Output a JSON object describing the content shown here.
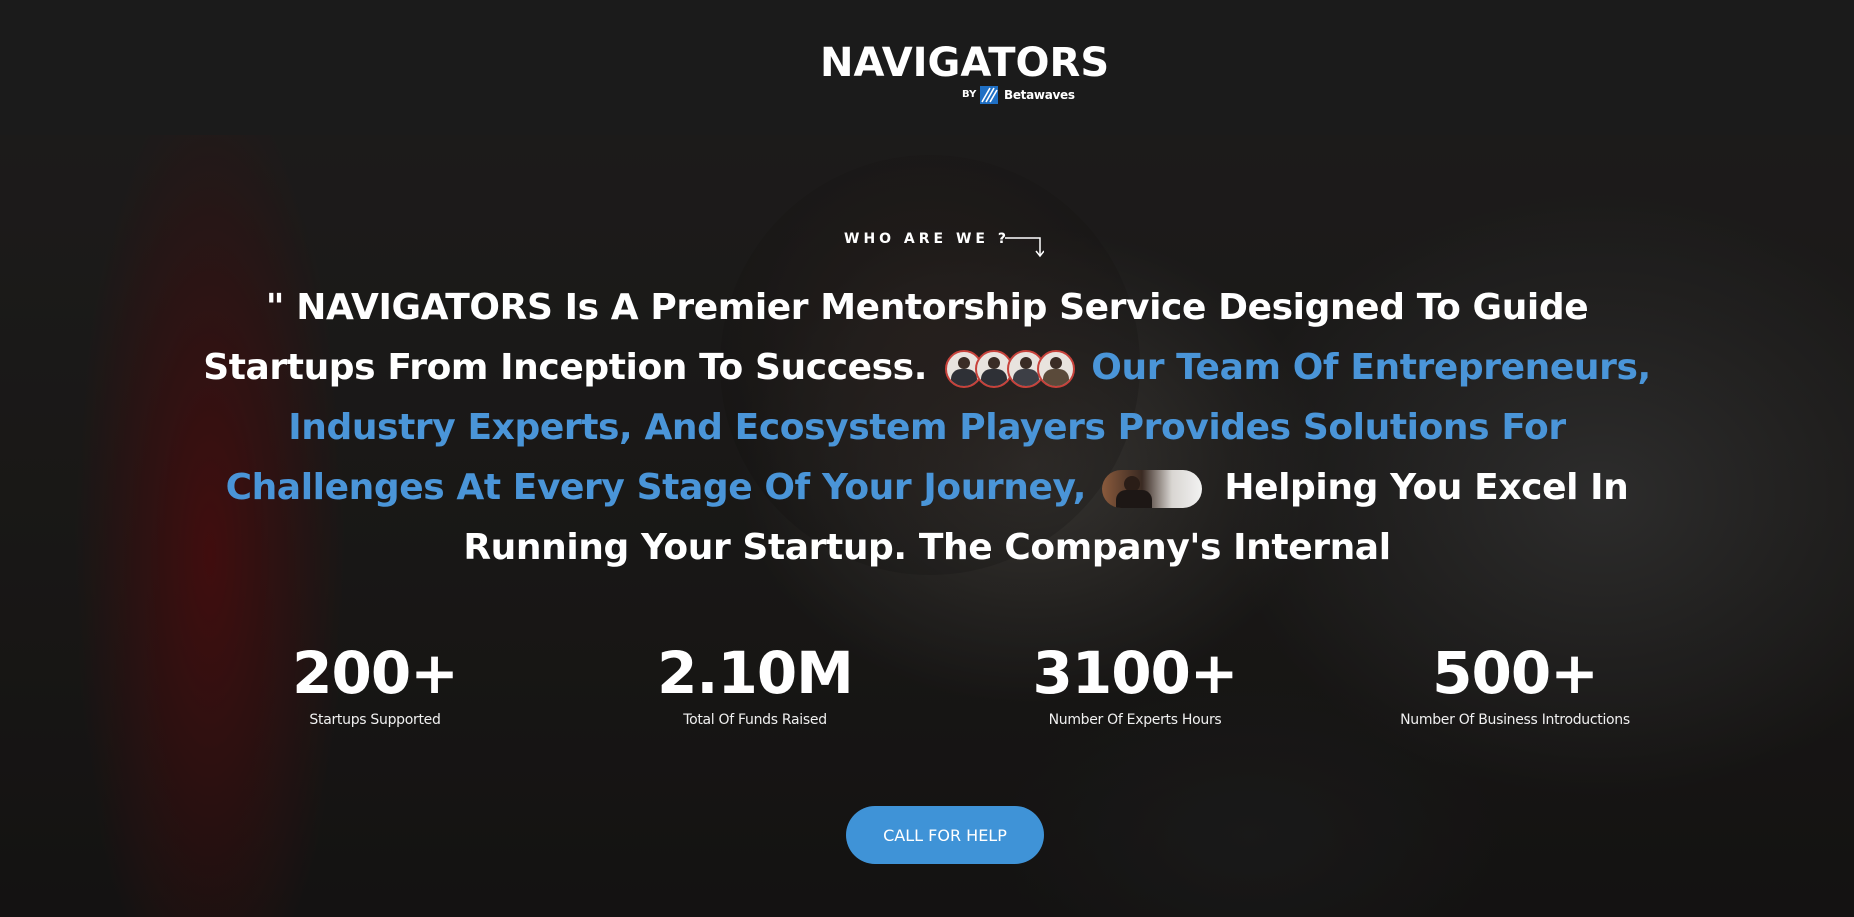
{
  "header": {
    "logo_text": "NAVIGATORS",
    "logo_by": "BY",
    "logo_company": "Betawaves"
  },
  "hero": {
    "eyebrow": "WHO ARE WE ?",
    "statement": {
      "part1": "\" NAVIGATORS Is A Premier Mentorship Service Designed To Guide Startups From Inception To Success.",
      "part2_highlight": "Our Team Of Entrepreneurs, Industry Experts, And Ecosystem Players Provides Solutions For Challenges At Every Stage Of Your Journey,",
      "part3": "Helping You Excel In Running Your Startup. The Company's Internal"
    },
    "highlight_color": "#4a95d8"
  },
  "stats": [
    {
      "value": "200+",
      "label": "Startups Supported"
    },
    {
      "value": "2.10M",
      "label": "Total Of Funds Raised"
    },
    {
      "value": "3100+",
      "label": "Number Of Experts Hours"
    },
    {
      "value": "500+",
      "label": "Number Of Business Introductions"
    }
  ],
  "cta": {
    "label": "CALL FOR HELP",
    "color": "#3f93d7"
  }
}
